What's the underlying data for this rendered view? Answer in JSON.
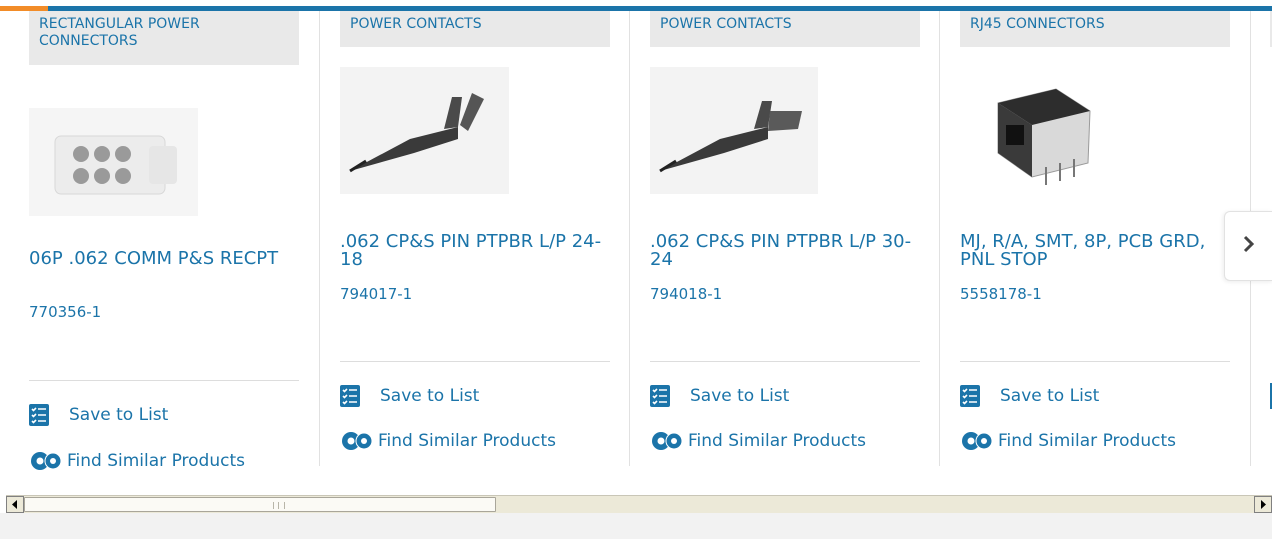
{
  "products": [
    {
      "category": "RECTANGULAR POWER CONNECTORS",
      "title": "06P .062 COMM P&S RECPT",
      "part_number": "770356-1",
      "image": "rectangular-connector-housing"
    },
    {
      "category": "POWER CONTACTS",
      "title": ".062 CP&S PIN PTPBR L/P 24-18",
      "part_number": "794017-1",
      "image": "pin-contact"
    },
    {
      "category": "POWER CONTACTS",
      "title": ".062 CP&S PIN PTPBR L/P 30-24",
      "part_number": "794018-1",
      "image": "pin-contact"
    },
    {
      "category": "RJ45 CONNECTORS",
      "title": "MJ, R/A, SMT, 8P, PCB GRD, PNL STOP",
      "part_number": "5558178-1",
      "image": "rj45-jack"
    }
  ],
  "actions": {
    "save_label": "Save to List",
    "similar_label": "Find Similar Products"
  },
  "icons": {
    "save": "checklist-icon",
    "similar": "gears-icon",
    "next": "chevron-right-icon"
  },
  "colors": {
    "brand_blue": "#1b74a9",
    "accent_orange": "#f28c28",
    "badge_bg": "#e9e9e9"
  }
}
